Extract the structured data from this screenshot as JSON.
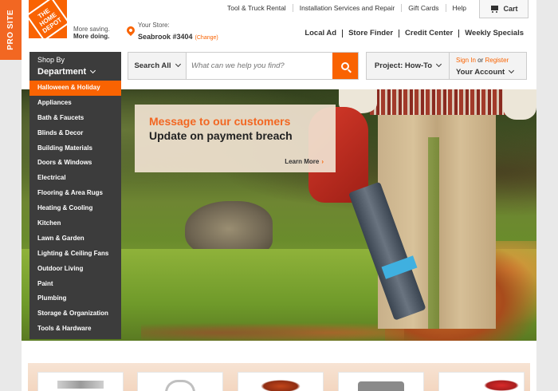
{
  "pro_site": {
    "label": "PRO SITE"
  },
  "logo": {
    "text": "THE HOME DEPOT"
  },
  "tagline": {
    "line1": "More saving.",
    "line2": "More doing."
  },
  "store": {
    "label": "Your Store:",
    "name": "Seabrook #3404",
    "change": "(Change)"
  },
  "utility_nav": [
    "Tool & Truck Rental",
    "Installation Services and Repair",
    "Gift Cards",
    "Help"
  ],
  "cart": {
    "label": "Cart"
  },
  "main_nav": [
    "Local Ad",
    "Store Finder",
    "Credit Center",
    "Weekly Specials"
  ],
  "shop_department": {
    "line1": "Shop By",
    "line2": "Department"
  },
  "search": {
    "scope": "Search All",
    "placeholder": "What can we help you find?"
  },
  "project": {
    "label": "Project: How-To"
  },
  "account": {
    "sign_in": "Sign In",
    "or": " or ",
    "register": "Register",
    "label": "Your Account"
  },
  "departments": [
    "Halloween & Holiday",
    "Appliances",
    "Bath & Faucets",
    "Blinds & Decor",
    "Building Materials",
    "Doors & Windows",
    "Electrical",
    "Flooring & Area Rugs",
    "Heating & Cooling",
    "Kitchen",
    "Lawn & Garden",
    "Lighting & Ceiling Fans",
    "Outdoor Living",
    "Paint",
    "Plumbing",
    "Storage & Organization",
    "Tools & Hardware"
  ],
  "promo": {
    "title": "Message to our customers",
    "subtitle": "Update on payment breach",
    "cta": "Learn More",
    "cta_icon": "chevron-right-icon"
  },
  "colors": {
    "brand_orange": "#f96302",
    "menu_dark": "#3c3c3c",
    "pro_tab": "#f26722"
  }
}
